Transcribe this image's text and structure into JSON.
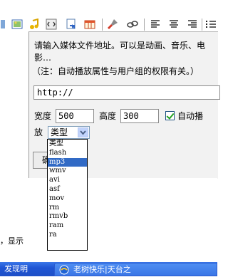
{
  "dialog": {
    "prompt_line1": "请输入媒体文件地址。可以是动画、音乐、电",
    "prompt_line2": "影…",
    "note": "（注：自动播放属性与用户组的权限有关。）",
    "url_value": "http://",
    "width_label": "宽度",
    "width_value": "500",
    "height_label": "高度",
    "height_value": "300",
    "autoplay_label": "自动播",
    "autoplay_label_cont": "放",
    "autoplay_checked": true,
    "type_selected": "类型",
    "confirm_label": "确"
  },
  "dropdown": {
    "options": [
      "类型",
      "flash",
      "mp3",
      "wmv",
      "avi",
      "asf",
      "mov",
      "rm",
      "rmvb",
      "ram",
      "ra"
    ],
    "highlighted": "mp3"
  },
  "page": {
    "bottom_text": "，显示"
  },
  "taskbar": {
    "left_label": "发现明",
    "task_label": "老树快乐|天台之"
  },
  "colors": {
    "dialog_bg": "#f2f2f2",
    "selection": "#316ac5",
    "taskbar": "#245edb",
    "check_mark": "#21a121"
  },
  "icons": [
    "image-icon",
    "music-note-icon",
    "flash-icon",
    "media-icon",
    "table-icon",
    "paint-icon",
    "link-icon",
    "align-left-icon",
    "align-center-icon",
    "align-right-icon",
    "list-icon"
  ]
}
